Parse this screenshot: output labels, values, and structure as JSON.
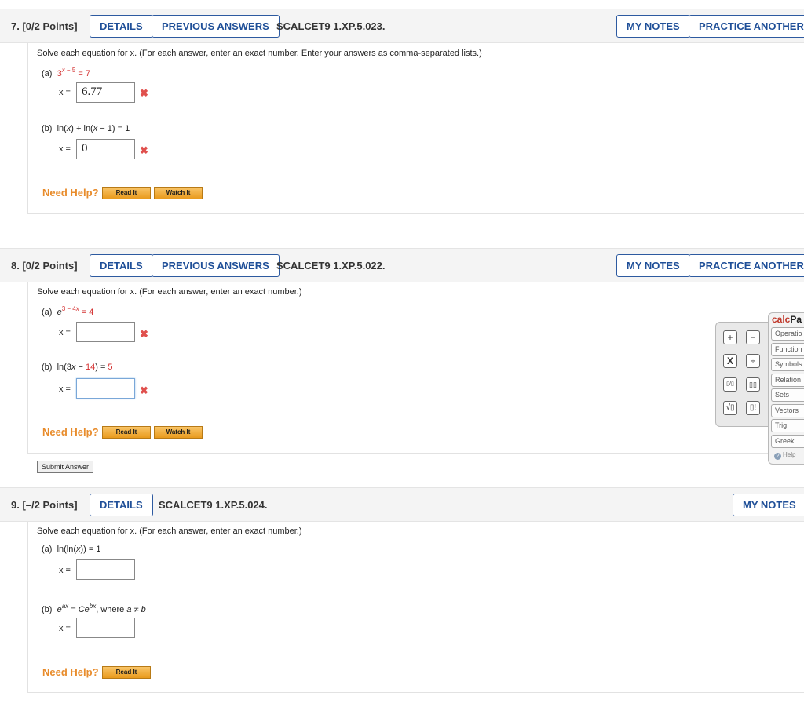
{
  "questions": [
    {
      "number": "7.",
      "points": "[0/2 Points]",
      "details_label": "DETAILS",
      "previous_answers_label": "PREVIOUS ANSWERS",
      "problem_id": "SCALCET9 1.XP.5.023.",
      "my_notes_label": "MY NOTES",
      "practice_another_label": "PRACTICE ANOTHER",
      "statement": "Solve each equation for x. (For each answer, enter an exact number. Enter your answers as comma-separated lists.)",
      "part_a": {
        "label": "(a)",
        "equation": "3^(x − 5) = 7",
        "answer": "6.77",
        "status": "incorrect"
      },
      "part_b": {
        "label": "(b)",
        "equation": "ln(x) + ln(x − 1) = 1",
        "answer": "0",
        "status": "incorrect"
      },
      "need_help": "Need Help?",
      "read_it": "Read It",
      "watch_it": "Watch It"
    },
    {
      "number": "8.",
      "points": "[0/2 Points]",
      "details_label": "DETAILS",
      "previous_answers_label": "PREVIOUS ANSWERS",
      "problem_id": "SCALCET9 1.XP.5.022.",
      "my_notes_label": "MY NOTES",
      "practice_another_label": "PRACTICE ANOTHER",
      "statement": "Solve each equation for x. (For each answer, enter an exact number.)",
      "part_a": {
        "label": "(a)",
        "equation": "e^(3 − 4x) = 4",
        "answer": "",
        "status": "incorrect"
      },
      "part_b": {
        "label": "(b)",
        "equation": "ln(3x − 14) = 5",
        "answer": "",
        "status": "incorrect"
      },
      "need_help": "Need Help?",
      "read_it": "Read It",
      "watch_it": "Watch It",
      "submit_label": "Submit Answer"
    },
    {
      "number": "9.",
      "points": "[–/2 Points]",
      "details_label": "DETAILS",
      "problem_id": "SCALCET9 1.XP.5.024.",
      "my_notes_label": "MY NOTES",
      "statement": "Solve each equation for x. (For each answer, enter an exact number.)",
      "part_a": {
        "label": "(a)",
        "equation": "ln(ln(x)) = 1",
        "answer": ""
      },
      "part_b": {
        "label": "(b)",
        "equation": "e^(ax) = Ce^(bx), where a ≠ b",
        "answer": ""
      },
      "need_help": "Need Help?",
      "read_it": "Read It"
    }
  ],
  "answer_var": "x =",
  "calcpad": {
    "title_prefix": "calc",
    "title_suffix": "Pa",
    "keys": [
      "+",
      "−",
      "X",
      "÷",
      "▯/▯",
      "▯▯",
      "√▯",
      "▯!"
    ],
    "tabs": [
      "Operatio",
      "Function",
      "Symbols",
      "Relation",
      "Sets",
      "Vectors",
      "Trig",
      "Greek"
    ],
    "help": "Help"
  },
  "colors": {
    "accent": "#1f4f98",
    "error": "#e0504d",
    "need_help": "#e88c2c",
    "equation_red": "#d32f2f"
  }
}
